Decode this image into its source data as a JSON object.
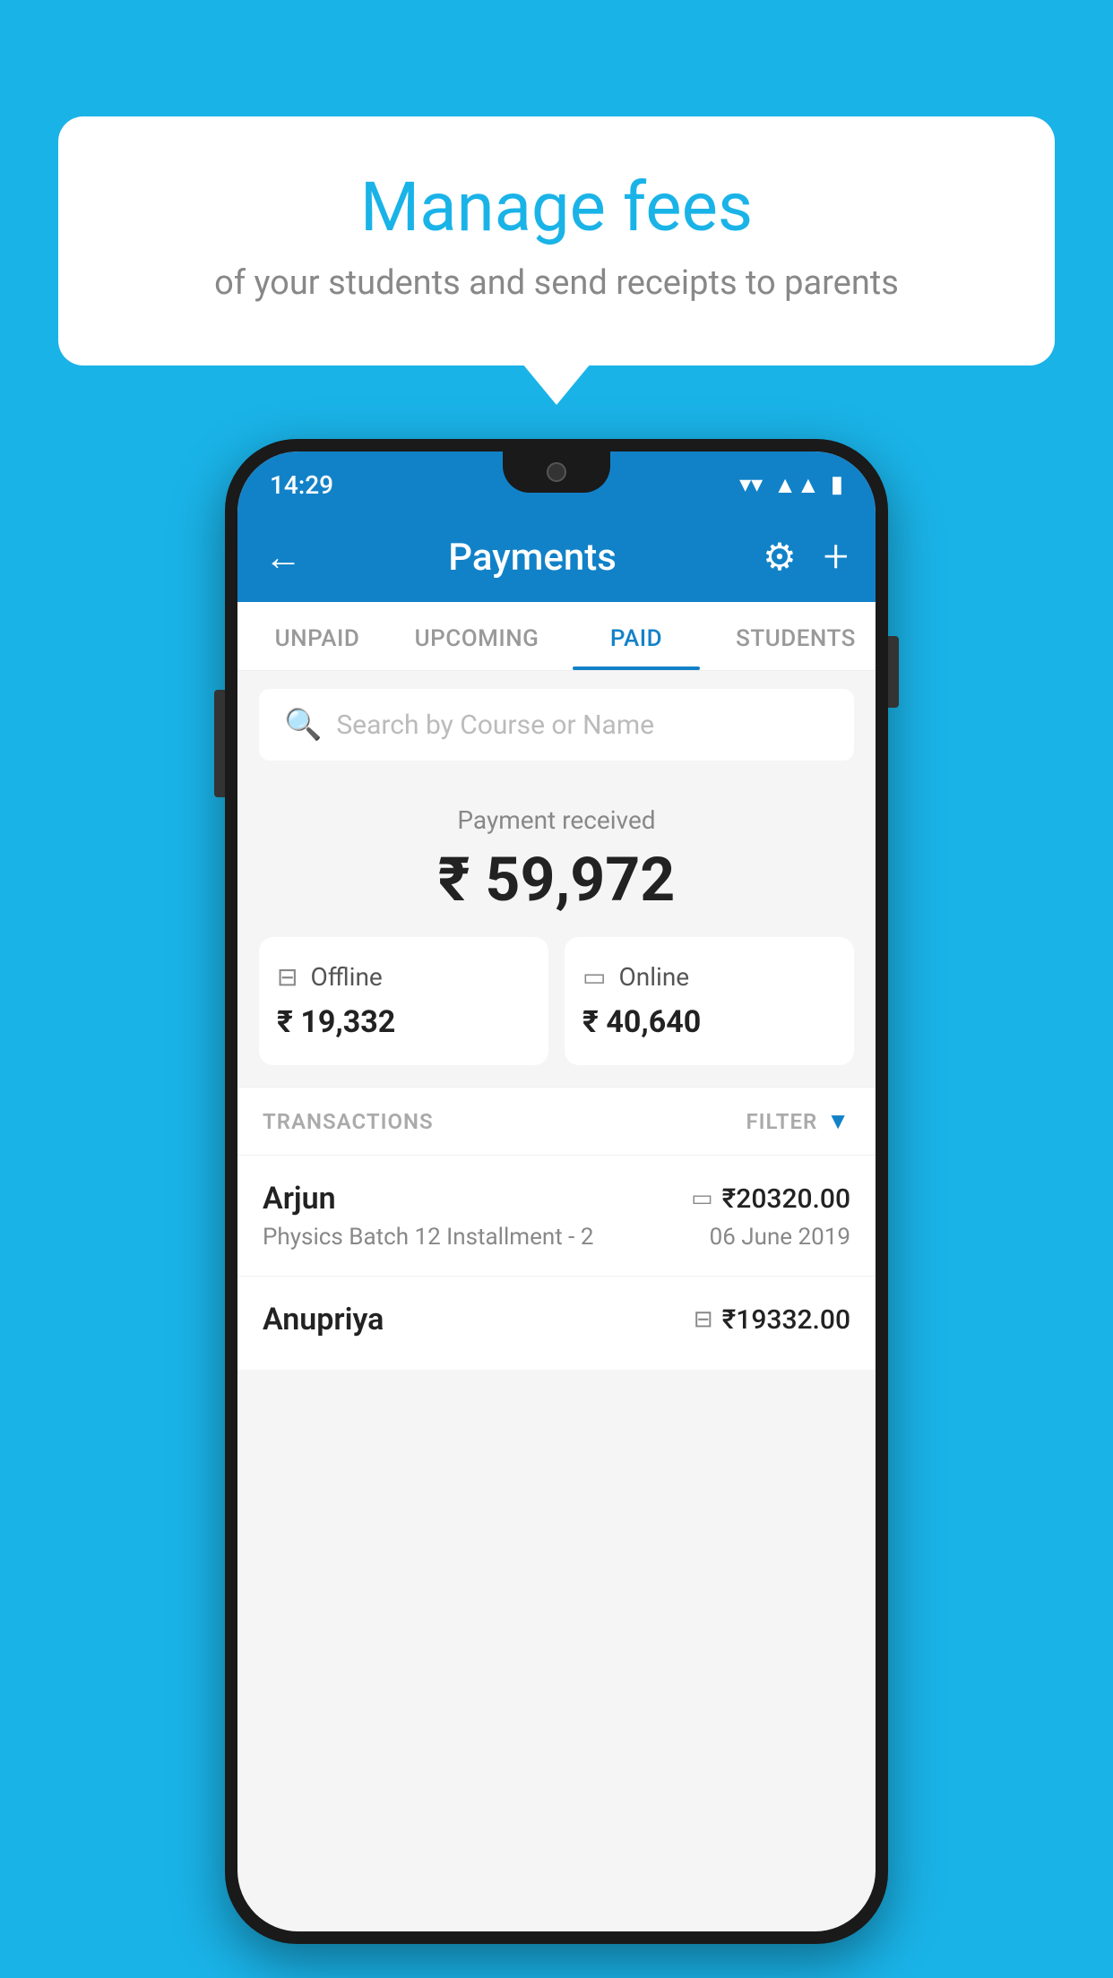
{
  "background_color": "#1ab3e8",
  "bubble": {
    "title": "Manage fees",
    "subtitle": "of your students and send receipts to parents"
  },
  "status_bar": {
    "time": "14:29",
    "icons": [
      "wifi",
      "signal",
      "battery"
    ]
  },
  "header": {
    "title": "Payments",
    "back_label": "←",
    "gear_label": "⚙",
    "plus_label": "+"
  },
  "tabs": [
    {
      "label": "UNPAID",
      "active": false
    },
    {
      "label": "UPCOMING",
      "active": false
    },
    {
      "label": "PAID",
      "active": true
    },
    {
      "label": "STUDENTS",
      "active": false
    }
  ],
  "search": {
    "placeholder": "Search by Course or Name"
  },
  "payment": {
    "section_label": "Payment received",
    "total_amount": "₹ 59,972",
    "offline_label": "Offline",
    "offline_amount": "₹ 19,332",
    "online_label": "Online",
    "online_amount": "₹ 40,640"
  },
  "transactions": {
    "header_label": "TRANSACTIONS",
    "filter_label": "FILTER",
    "rows": [
      {
        "name": "Arjun",
        "description": "Physics Batch 12 Installment - 2",
        "amount": "₹20320.00",
        "date": "06 June 2019",
        "type": "online"
      },
      {
        "name": "Anupriya",
        "description": "",
        "amount": "₹19332.00",
        "date": "",
        "type": "offline"
      }
    ]
  }
}
